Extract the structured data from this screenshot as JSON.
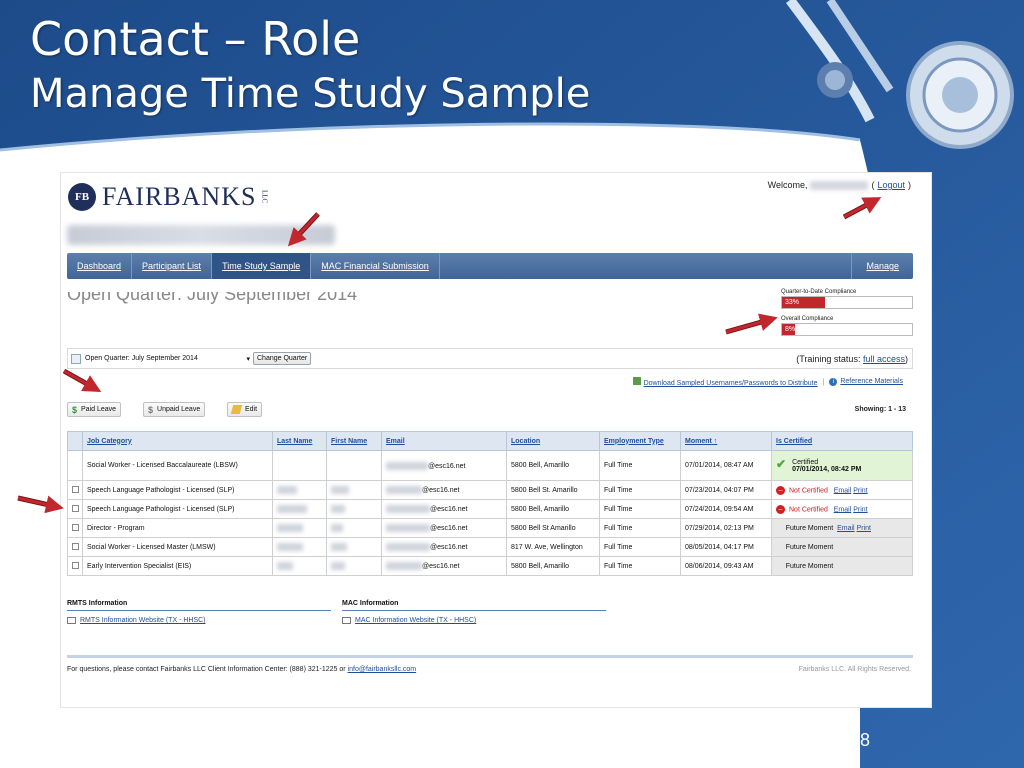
{
  "slide": {
    "title_line1": "Contact – Role",
    "title_line2": "Manage Time Study Sample",
    "page_number": "18",
    "colors": {
      "background": "#2a5b9c",
      "accent_arrow": "#c1272d"
    }
  },
  "app": {
    "logo_badge": "FB",
    "logo_text": "FAIRBANKS",
    "logo_llc": "LLC",
    "welcome_label": "Welcome,",
    "logout_label": "Logout",
    "nav": {
      "items": [
        {
          "label": "Dashboard"
        },
        {
          "label": "Participant List"
        },
        {
          "label": "Time Study Sample",
          "active": true
        },
        {
          "label": "MAC Financial Submission"
        }
      ],
      "manage_label": "Manage"
    },
    "quarter_heading": "Open Quarter: July September 2014",
    "compliance": {
      "quarter_label": "Quarter-to-Date Compliance",
      "quarter_value": "33%",
      "quarter_fraction": 0.33,
      "overall_label": "Overall Compliance",
      "overall_value": "8%",
      "overall_fraction": 0.08
    },
    "quarter_select": {
      "selected": "Open Quarter: July September 2014",
      "change_button": "Change Quarter"
    },
    "training_status_label": "(Training status:",
    "training_status_link": "full access",
    "training_status_end": ")",
    "download_link": "Download Sampled Usernames/Passwords to Distribute",
    "reference_link": "Reference Materials",
    "buttons": {
      "paid_leave": "Paid Leave",
      "unpaid_leave": "Unpaid Leave",
      "edit": "Edit"
    },
    "showing": "Showing: 1 - 13",
    "table": {
      "headers": [
        "Job Category",
        "Last Name",
        "First Name",
        "Email",
        "Location",
        "Employment Type",
        "Moment",
        "Is Certified"
      ],
      "rows": [
        {
          "job": "Social Worker - Licensed Baccalaureate (LBSW)",
          "email": "@esc16.net",
          "location": "5800 Bell, Amarillo",
          "type": "Full Time",
          "moment": "07/01/2014, 08:47 AM",
          "status": "Certified",
          "status_date": "07/01/2014, 08:42 PM"
        },
        {
          "job": "Speech Language Pathologist - Licensed (SLP)",
          "email": "@esc16.net",
          "location": "5800 Bell St. Amarillo",
          "type": "Full Time",
          "moment": "07/23/2014, 04:07 PM",
          "status": "Not Certified",
          "email_link": "Email",
          "print_link": "Print"
        },
        {
          "job": "Speech Language Pathologist - Licensed (SLP)",
          "email": "@esc16.net",
          "location": "5800 Bell, Amarillo",
          "type": "Full Time",
          "moment": "07/24/2014, 09:54 AM",
          "status": "Not Certified",
          "email_link": "Email",
          "print_link": "Print"
        },
        {
          "job": "Director - Program",
          "email": "@esc16.net",
          "location": "5800 Bell St Amarillo",
          "type": "Full Time",
          "moment": "07/29/2014, 02:13 PM",
          "status": "Future Moment",
          "email_link": "Email",
          "print_link": "Print"
        },
        {
          "job": "Social Worker - Licensed Master (LMSW)",
          "email": "@esc16.net",
          "location": "817 W. Ave, Wellington",
          "type": "Full Time",
          "moment": "08/05/2014, 04:17 PM",
          "status": "Future Moment"
        },
        {
          "job": "Early Intervention Specialist (EIS)",
          "email": "@esc16.net",
          "location": "5800 Bell, Amarillo",
          "type": "Full Time",
          "moment": "08/06/2014, 09:43 AM",
          "status": "Future Moment"
        }
      ]
    },
    "rmts": {
      "heading": "RMTS Information",
      "link": "RMTS Information Website (TX - HHSC)"
    },
    "mac": {
      "heading": "MAC Information",
      "link": "MAC Information Website (TX - HHSC)"
    },
    "footer": {
      "text": "For questions, please contact Fairbanks LLC Client Information Center: (888) 321-1225 or",
      "email": "info@fairbanksllc.com",
      "rights": "Fairbanks LLC. All Rights Reserved."
    }
  }
}
